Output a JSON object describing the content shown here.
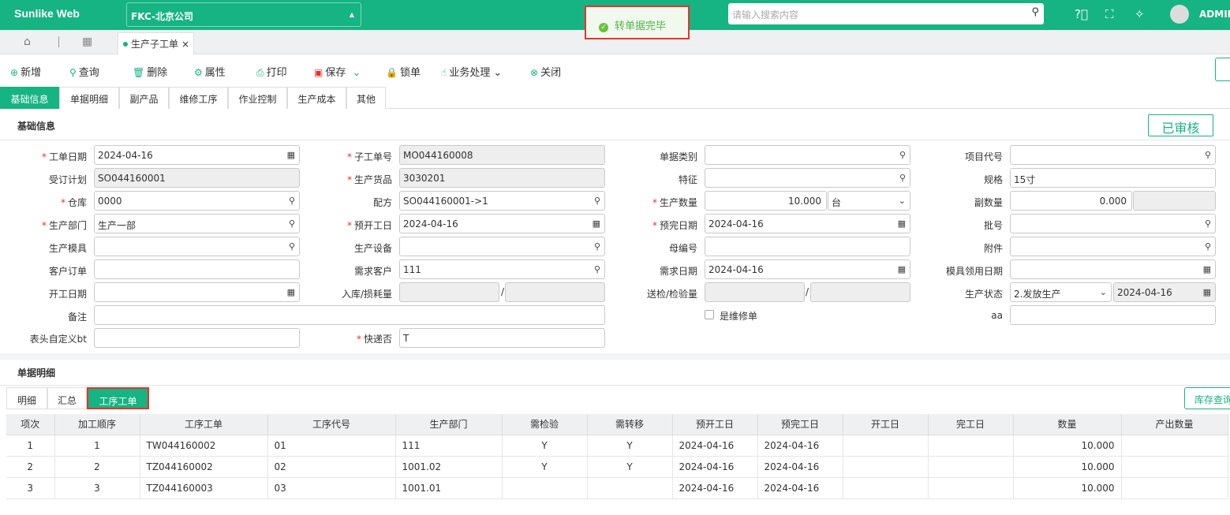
{
  "header": {
    "app_title": "Sunlike Web",
    "company": "FKC-北京公司",
    "search_placeholder": "请输入搜索内容",
    "user": "ADMIN",
    "toast": "转单据完毕"
  },
  "page_tab": {
    "label": "生产子工单",
    "close": "×"
  },
  "toolbar": {
    "add": "新增",
    "query": "查询",
    "delete": "删除",
    "property": "属性",
    "print": "打印",
    "save": "保存",
    "lock": "锁单",
    "business": "业务处理",
    "close": "关闭"
  },
  "form_tabs": [
    "基础信息",
    "单据明细",
    "副产品",
    "维修工序",
    "作业控制",
    "生产成本",
    "其他"
  ],
  "section": {
    "basic": "基础信息",
    "detail": "单据明细",
    "status_stamp": "已审核"
  },
  "form": {
    "work_date": {
      "label": "工单日期",
      "value": "2024-04-16"
    },
    "sub_order_no": {
      "label": "子工单号",
      "value": "MO044160008"
    },
    "doc_category": {
      "label": "单据类别",
      "value": ""
    },
    "project_code": {
      "label": "项目代号",
      "value": ""
    },
    "order_plan": {
      "label": "受订计划",
      "value": "SO044160001"
    },
    "product": {
      "label": "生产货品",
      "value": "3030201"
    },
    "feature": {
      "label": "特征",
      "value": ""
    },
    "spec": {
      "label": "规格",
      "value": "15寸"
    },
    "warehouse": {
      "label": "仓库",
      "value": "0000"
    },
    "formula": {
      "label": "配方",
      "value": "SO044160001->1"
    },
    "quantity": {
      "label": "生产数量",
      "value": "10.000",
      "unit": "台"
    },
    "sub_quantity": {
      "label": "副数量",
      "value": "0.000"
    },
    "dept": {
      "label": "生产部门",
      "value": "生产一部"
    },
    "plan_start": {
      "label": "预开工日",
      "value": "2024-04-16"
    },
    "plan_finish": {
      "label": "预完日期",
      "value": "2024-04-16"
    },
    "batch": {
      "label": "批号",
      "value": ""
    },
    "mold": {
      "label": "生产模具",
      "value": ""
    },
    "equipment": {
      "label": "生产设备",
      "value": ""
    },
    "parent_no": {
      "label": "母编号",
      "value": ""
    },
    "attachment": {
      "label": "附件",
      "value": ""
    },
    "customer_order": {
      "label": "客户订单",
      "value": ""
    },
    "demand_customer": {
      "label": "需求客户",
      "value": "111"
    },
    "demand_date": {
      "label": "需求日期",
      "value": "2024-04-16"
    },
    "mold_date": {
      "label": "模具领用日期",
      "value": ""
    },
    "start_date": {
      "label": "开工日期",
      "value": ""
    },
    "stock_loss": {
      "label": "入库/损耗量",
      "sep": "/"
    },
    "inspection": {
      "label": "送检/检验量",
      "sep": "/"
    },
    "prod_status": {
      "label": "生产状态",
      "value": "2.发放生产",
      "date": "2024-04-16"
    },
    "remark": {
      "label": "备注",
      "value": ""
    },
    "is_repair": {
      "label": "是维修单"
    },
    "aa": {
      "label": "aa",
      "value": ""
    },
    "custom_bt": {
      "label": "表头自定义bt",
      "value": ""
    },
    "express": {
      "label": "快递否",
      "value": "T"
    }
  },
  "detail_tabs": [
    "明细",
    "汇总",
    "工序工单"
  ],
  "stock_query": "库存查询",
  "table": {
    "headers": [
      "项次",
      "加工顺序",
      "工序工单",
      "工序代号",
      "生产部门",
      "需检验",
      "需转移",
      "预开工日",
      "预完工日",
      "开工日",
      "完工日",
      "数量",
      "产出数量"
    ],
    "rows": [
      [
        "1",
        "1",
        "TW044160002",
        "01",
        "111",
        "Y",
        "Y",
        "2024-04-16",
        "2024-04-16",
        "",
        "",
        "10.000",
        ""
      ],
      [
        "2",
        "2",
        "TZ044160002",
        "02",
        "1001.02",
        "Y",
        "Y",
        "2024-04-16",
        "2024-04-16",
        "",
        "",
        "10.000",
        ""
      ],
      [
        "3",
        "3",
        "TZ044160003",
        "03",
        "1001.01",
        "",
        "",
        "2024-04-16",
        "2024-04-16",
        "",
        "",
        "10.000",
        ""
      ]
    ]
  }
}
